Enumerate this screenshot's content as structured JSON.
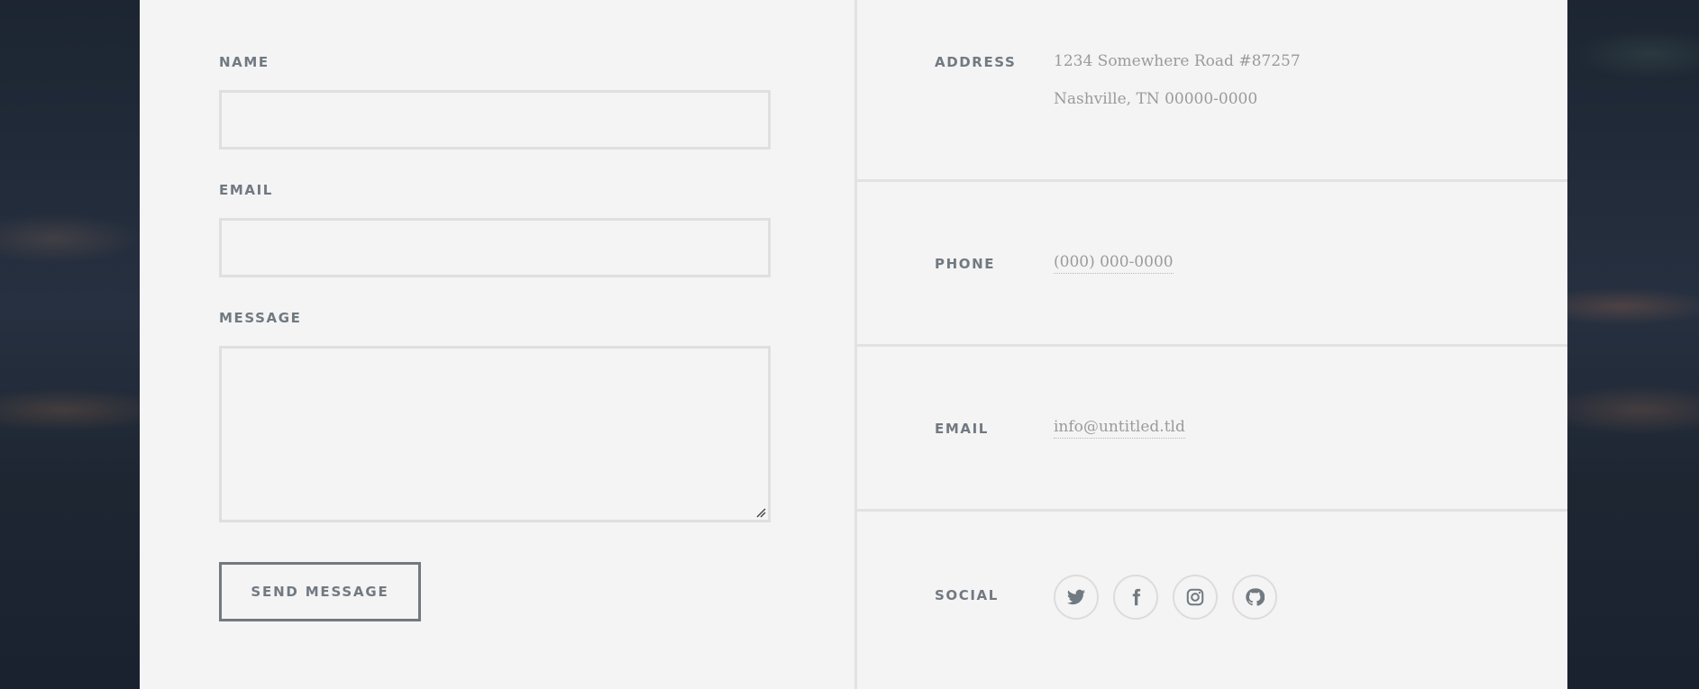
{
  "form": {
    "name_label": "Name",
    "name_value": "",
    "email_label": "Email",
    "email_value": "",
    "message_label": "Message",
    "message_value": "",
    "submit_label": "Send Message"
  },
  "contact": {
    "address_label": "Address",
    "address_line1": "1234 Somewhere Road #87257",
    "address_line2": "Nashville, TN 00000-0000",
    "phone_label": "Phone",
    "phone_value": "(000) 000-0000",
    "email_label": "Email",
    "email_value": "info@untitled.tld",
    "social_label": "Social",
    "social_links": [
      {
        "icon": "twitter-icon"
      },
      {
        "icon": "facebook-icon"
      },
      {
        "icon": "instagram-icon"
      },
      {
        "icon": "github-icon"
      }
    ]
  },
  "colors": {
    "panel_background": "#f4f4f4",
    "label": "#717981",
    "body_text": "#9a9a9a",
    "border": "#dfdfdf"
  }
}
